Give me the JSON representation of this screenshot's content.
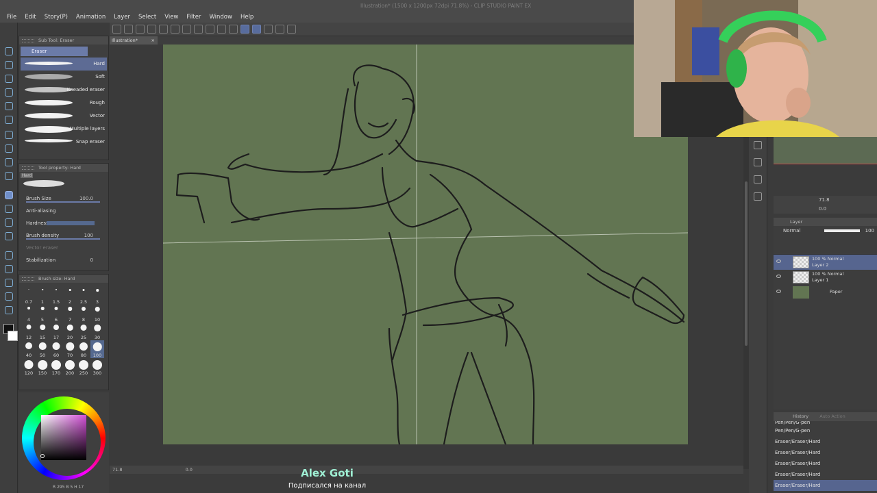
{
  "menubar": {
    "items": [
      "File",
      "Edit",
      "Story(P)",
      "Animation",
      "Layer",
      "Select",
      "View",
      "Filter",
      "Window",
      "Help"
    ],
    "window_title": "Illustration* (1500 x 1200px 72dpi 71.8%) - CLIP STUDIO PAINT EX"
  },
  "document_tab": {
    "label": "Illustration*",
    "close": "×"
  },
  "subtool": {
    "header": "Sub Tool: Eraser",
    "group": "Eraser",
    "brushes": [
      "Hard",
      "Soft",
      "Kneaded eraser",
      "Rough",
      "Vector",
      "Multiple layers",
      "Snap eraser"
    ],
    "selected_index": 0
  },
  "tool_property": {
    "header": "Tool property: Hard",
    "preset": "Hard",
    "brush_size_label": "Brush Size",
    "brush_size_value": "100.0",
    "antialiasing_label": "Anti-aliasing",
    "hardness_label": "Hardness",
    "density_label": "Brush density",
    "density_value": "100",
    "vector_eraser_label": "Vector eraser",
    "stabilization_label": "Stabilization",
    "stabilization_value": "0"
  },
  "brush_size_panel": {
    "header": "Brush size: Hard",
    "sizes": [
      "0.7",
      "1",
      "1.5",
      "2",
      "2.5",
      "3",
      "4",
      "5",
      "6",
      "7",
      "8",
      "10",
      "12",
      "15",
      "17",
      "20",
      "25",
      "30",
      "40",
      "50",
      "60",
      "70",
      "80",
      "100",
      "120",
      "150",
      "170",
      "200",
      "250",
      "300"
    ],
    "selected": "100"
  },
  "colors": {
    "canvas": "#627552",
    "selection": "#56658f",
    "overlay_name": "#9ff0d4"
  },
  "statusbar": {
    "zoom": "71.8",
    "angle": "0.0"
  },
  "color_status": "R 295 B 5 H 17",
  "navigator": {
    "zoom": "71.8",
    "angle": "0.0"
  },
  "layer_panel": {
    "header": "Layer",
    "blend_mode": "Normal",
    "opacity": "100",
    "layers": [
      {
        "l1": "100 % Normal",
        "l2": "Layer 2",
        "selected": true,
        "thumb": "checker"
      },
      {
        "l1": "100 % Normal",
        "l2": "Layer 1",
        "selected": false,
        "thumb": "checker"
      },
      {
        "l1": "",
        "l2": "Paper",
        "selected": false,
        "thumb": "green"
      }
    ]
  },
  "history": {
    "header": "History",
    "tab2": "Auto Action",
    "items": [
      "Pen/Pen/G-pen",
      "Pen/Pen/G-pen",
      "Eraser/Eraser/Hard",
      "Eraser/Eraser/Hard",
      "Eraser/Eraser/Hard",
      "Eraser/Eraser/Hard",
      "Eraser/Eraser/Hard"
    ],
    "selected_index": 6
  },
  "overlay": {
    "name": "Alex Goti",
    "subtitle": "Подписался на канал"
  }
}
